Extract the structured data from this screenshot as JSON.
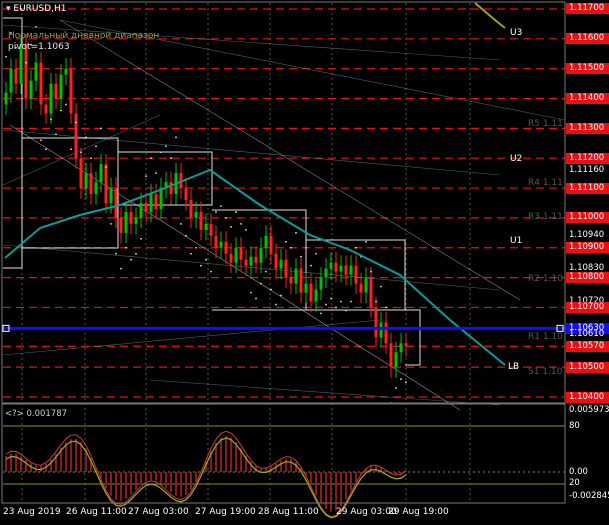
{
  "chart_header": {
    "symbol": "EURUSD,H1",
    "indicator_name": "Нормальный дневной диапазон",
    "pivot_text": "pivot=1.1063"
  },
  "oscillator_header": "<?> 0.001787",
  "colors": {
    "background": "#000000",
    "bull_candle": "#00c000",
    "bear_candle": "#ff2020",
    "resistance_lines": "#e81010",
    "pivot_line": "#1010f0",
    "ma_line": "#0d9a9a",
    "channel_line": "#d8d8d8",
    "osc_line": "#a0a020",
    "osc_hist": "#8b1a1a"
  },
  "levels": {
    "U3": "U3",
    "U2": "U2",
    "U1": "U1",
    "LB": "LB",
    "R3": "R3 1.11",
    "R4": "R4 1.11",
    "R5": "R5 1.11",
    "R2": "R2 1.10",
    "R1": "R1 1.10",
    "S1": "S1 1.10"
  },
  "price_axis": [
    {
      "label": "1.11700",
      "price": 1.117,
      "style": "red"
    },
    {
      "label": "1.11600",
      "price": 1.116,
      "style": "red"
    },
    {
      "label": "1.11500",
      "price": 1.115,
      "style": "red"
    },
    {
      "label": "1.11400",
      "price": 1.114,
      "style": "red"
    },
    {
      "label": "1.11300",
      "price": 1.113,
      "style": "red"
    },
    {
      "label": "1.11200",
      "price": 1.112,
      "style": "red"
    },
    {
      "label": "1.11160",
      "price": 1.1116,
      "style": "text"
    },
    {
      "label": "1.11100",
      "price": 1.111,
      "style": "red"
    },
    {
      "label": "1.11000",
      "price": 1.11,
      "style": "red"
    },
    {
      "label": "1.10940",
      "price": 1.1094,
      "style": "text"
    },
    {
      "label": "1.10900",
      "price": 1.109,
      "style": "red"
    },
    {
      "label": "1.10830",
      "price": 1.1083,
      "style": "text"
    },
    {
      "label": "1.10800",
      "price": 1.108,
      "style": "red"
    },
    {
      "label": "1.10720",
      "price": 1.1072,
      "style": "text"
    },
    {
      "label": "1.10700",
      "price": 1.107,
      "style": "red"
    },
    {
      "label": "1.10630",
      "price": 1.1063,
      "style": "blue"
    },
    {
      "label": "1.10610",
      "price": 1.1061,
      "style": "text"
    },
    {
      "label": "1.10570",
      "price": 1.1057,
      "style": "red"
    },
    {
      "label": "1.10500",
      "price": 1.105,
      "style": "red"
    },
    {
      "label": "1.10400",
      "price": 1.104,
      "style": "red"
    }
  ],
  "osc_axis": [
    {
      "label": "0.005973",
      "style": "text"
    },
    {
      "label": "80",
      "style": "text"
    },
    {
      "label": "0.00",
      "style": "text"
    },
    {
      "label": "20",
      "style": "text"
    },
    {
      "label": "-0.002845",
      "style": "text"
    }
  ],
  "time_axis": [
    "23 Aug 2019",
    "26 Aug 11:00",
    "27 Aug 03:00",
    "27 Aug 19:00",
    "28 Aug 11:00",
    "29 Aug 03:00",
    "29 Aug 19:00"
  ],
  "chart_data": {
    "type": "candlestick",
    "title": "EURUSD,H1",
    "ylim": [
      1.1035,
      1.1172
    ],
    "closes": [
      1.1142,
      1.115,
      1.1145,
      1.1158,
      1.114,
      1.1146,
      1.1152,
      1.1138,
      1.1135,
      1.1145,
      1.114,
      1.1148,
      1.115,
      1.1135,
      1.112,
      1.111,
      1.1115,
      1.1108,
      1.1112,
      1.1118,
      1.1105,
      1.111,
      1.11,
      1.1095,
      1.1102,
      1.1098,
      1.11,
      1.1105,
      1.1102,
      1.1108,
      1.1103,
      1.111,
      1.1112,
      1.1108,
      1.1115,
      1.111,
      1.1106,
      1.11,
      1.1102,
      1.1096,
      1.1098,
      1.1094,
      1.109,
      1.1092,
      1.1088,
      1.1085,
      1.109,
      1.1086,
      1.1084,
      1.1087,
      1.1085,
      1.109,
      1.1094,
      1.1088,
      1.1083,
      1.1086,
      1.108,
      1.1078,
      1.1083,
      1.1075,
      1.1078,
      1.1072,
      1.1076,
      1.108,
      1.1083,
      1.1085,
      1.1082,
      1.1084,
      1.1081,
      1.1084,
      1.1078,
      1.1075,
      1.108,
      1.107,
      1.106,
      1.1065,
      1.1058,
      1.105,
      1.1055,
      1.1058,
      1.1057
    ]
  }
}
